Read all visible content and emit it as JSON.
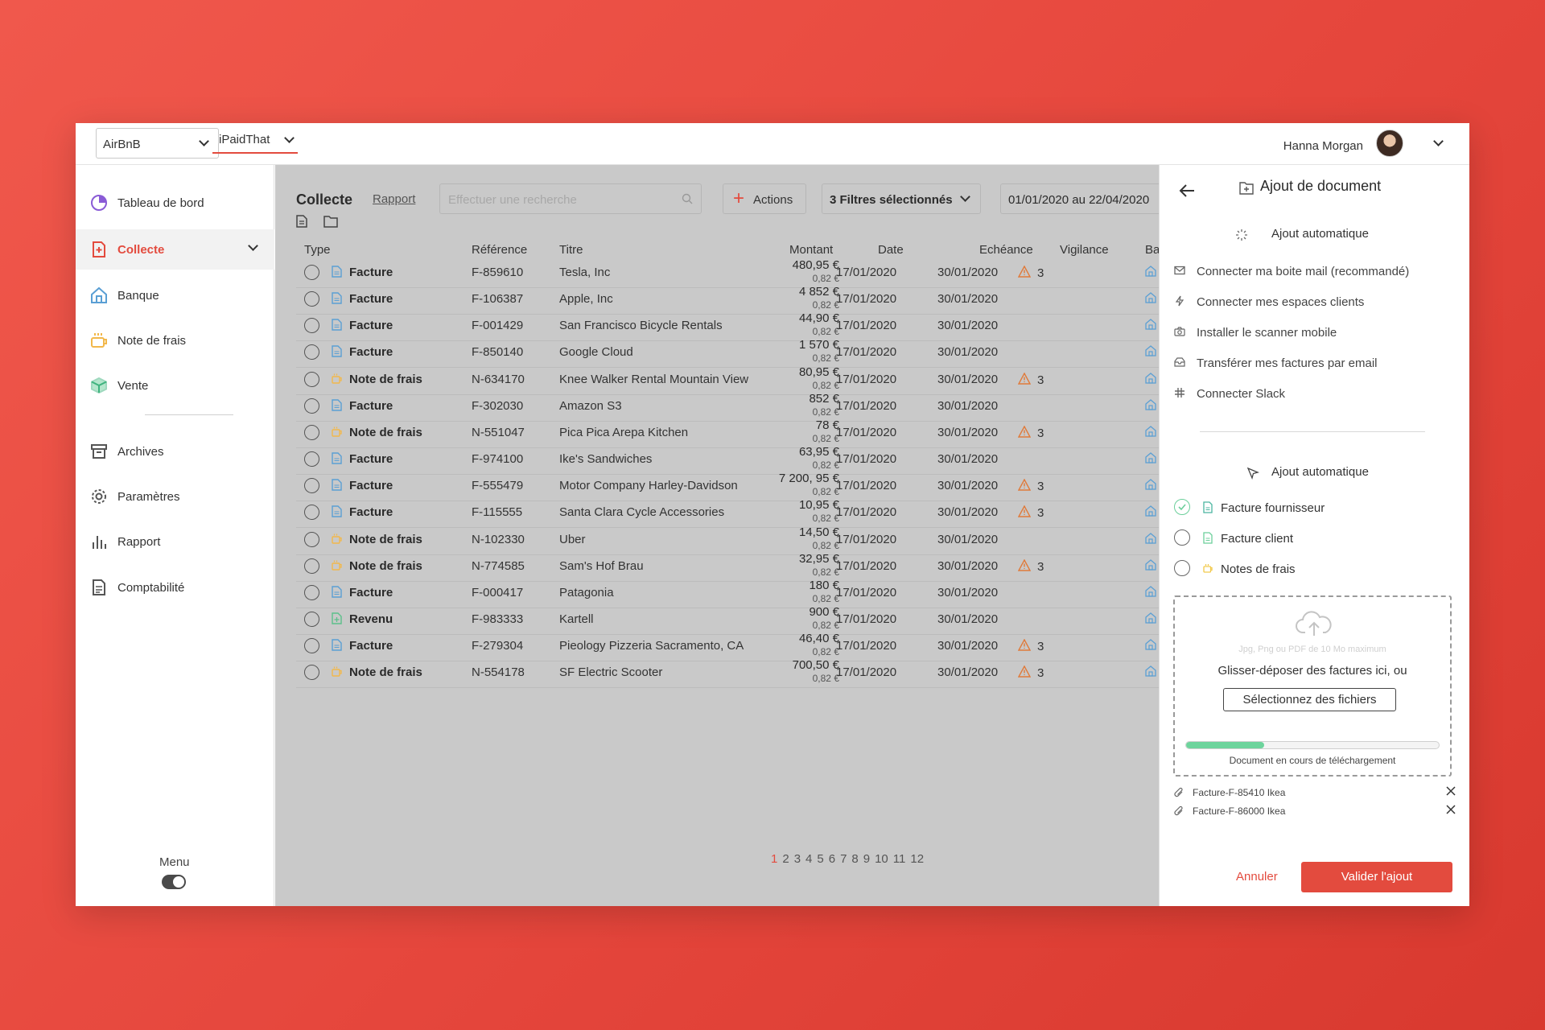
{
  "header": {
    "company_select": "AirBnB",
    "app_select": "iPaidThat",
    "user_name": "Hanna Morgan"
  },
  "sidebar": {
    "items": [
      {
        "label": "Tableau de bord",
        "icon": "dashboard-icon"
      },
      {
        "label": "Collecte",
        "icon": "collect-icon",
        "active": true
      },
      {
        "label": "Banque",
        "icon": "bank-icon"
      },
      {
        "label": "Note de frais",
        "icon": "expense-icon"
      },
      {
        "label": "Vente",
        "icon": "sale-icon"
      },
      {
        "label": "Archives",
        "icon": "archive-icon"
      },
      {
        "label": "Paramètres",
        "icon": "settings-icon"
      },
      {
        "label": "Rapport",
        "icon": "report-icon"
      },
      {
        "label": "Comptabilité",
        "icon": "accounting-icon"
      }
    ],
    "menu_label": "Menu"
  },
  "main": {
    "title": "Collecte",
    "tab_rapport": "Rapport",
    "search_placeholder": "Effectuer une recherche",
    "actions_label": "Actions",
    "filters_label": "3 Filtres sélectionnés",
    "date_range": "01/01/2020 au 22/04/2020",
    "columns": [
      "Type",
      "Référence",
      "Titre",
      "Montant",
      "Date",
      "Echéance",
      "Vigilance",
      "Banq"
    ],
    "rows": [
      {
        "type": "Facture",
        "kind": "invoice",
        "ref": "F-859610",
        "title": "Tesla, Inc",
        "amount": "480,95 €",
        "sub": "0,82 €",
        "date": "17/01/2020",
        "due": "30/01/2020",
        "vig": "3"
      },
      {
        "type": "Facture",
        "kind": "invoice",
        "ref": "F-106387",
        "title": "Apple, Inc",
        "amount": "4 852 €",
        "sub": "0,82 €",
        "date": "17/01/2020",
        "due": "30/01/2020",
        "vig": ""
      },
      {
        "type": "Facture",
        "kind": "invoice",
        "ref": "F-001429",
        "title": "San Francisco Bicycle Rentals",
        "amount": "44,90 €",
        "sub": "0,82 €",
        "date": "17/01/2020",
        "due": "30/01/2020",
        "vig": ""
      },
      {
        "type": "Facture",
        "kind": "invoice",
        "ref": "F-850140",
        "title": "Google Cloud",
        "amount": "1 570 €",
        "sub": "0,82 €",
        "date": "17/01/2020",
        "due": "30/01/2020",
        "vig": ""
      },
      {
        "type": "Note de frais",
        "kind": "expense",
        "ref": "N-634170",
        "title": "Knee Walker Rental Mountain View",
        "amount": "80,95 €",
        "sub": "0,82 €",
        "date": "17/01/2020",
        "due": "30/01/2020",
        "vig": "3"
      },
      {
        "type": "Facture",
        "kind": "invoice",
        "ref": "F-302030",
        "title": "Amazon S3",
        "amount": "852 €",
        "sub": "0,82 €",
        "date": "17/01/2020",
        "due": "30/01/2020",
        "vig": ""
      },
      {
        "type": "Note de frais",
        "kind": "expense",
        "ref": "N-551047",
        "title": "Pica Pica Arepa Kitchen",
        "amount": "78 €",
        "sub": "0,82 €",
        "date": "17/01/2020",
        "due": "30/01/2020",
        "vig": "3"
      },
      {
        "type": "Facture",
        "kind": "invoice",
        "ref": "F-974100",
        "title": "Ike's Sandwiches",
        "amount": "63,95 €",
        "sub": "0,82 €",
        "date": "17/01/2020",
        "due": "30/01/2020",
        "vig": ""
      },
      {
        "type": "Facture",
        "kind": "invoice",
        "ref": "F-555479",
        "title": "Motor Company Harley-Davidson",
        "amount": "7 200, 95 €",
        "sub": "0,82 €",
        "date": "17/01/2020",
        "due": "30/01/2020",
        "vig": "3"
      },
      {
        "type": "Facture",
        "kind": "invoice",
        "ref": "F-115555",
        "title": "Santa Clara Cycle Accessories",
        "amount": "10,95 €",
        "sub": "0,82 €",
        "date": "17/01/2020",
        "due": "30/01/2020",
        "vig": "3"
      },
      {
        "type": "Note de frais",
        "kind": "expense",
        "ref": "N-102330",
        "title": "Uber",
        "amount": "14,50 €",
        "sub": "0,82 €",
        "date": "17/01/2020",
        "due": "30/01/2020",
        "vig": ""
      },
      {
        "type": "Note de frais",
        "kind": "expense",
        "ref": "N-774585",
        "title": "Sam's Hof Brau",
        "amount": "32,95 €",
        "sub": "0,82 €",
        "date": "17/01/2020",
        "due": "30/01/2020",
        "vig": "3"
      },
      {
        "type": "Facture",
        "kind": "invoice",
        "ref": "F-000417",
        "title": "Patagonia",
        "amount": "180 €",
        "sub": "0,82 €",
        "date": "17/01/2020",
        "due": "30/01/2020",
        "vig": ""
      },
      {
        "type": "Revenu",
        "kind": "revenue",
        "ref": "F-983333",
        "title": "Kartell",
        "amount": "900 €",
        "sub": "0,82 €",
        "date": "17/01/2020",
        "due": "30/01/2020",
        "vig": ""
      },
      {
        "type": "Facture",
        "kind": "invoice",
        "ref": "F-279304",
        "title": "Pieology Pizzeria Sacramento, CA",
        "amount": "46,40 €",
        "sub": "0,82 €",
        "date": "17/01/2020",
        "due": "30/01/2020",
        "vig": "3"
      },
      {
        "type": "Note de frais",
        "kind": "expense",
        "ref": "N-554178",
        "title": "SF Electric Scooter",
        "amount": "700,50 €",
        "sub": "0,82 €",
        "date": "17/01/2020",
        "due": "30/01/2020",
        "vig": "3"
      }
    ],
    "pages": [
      "1",
      "2",
      "3",
      "4",
      "5",
      "6",
      "7",
      "8",
      "9",
      "10",
      "11",
      "12"
    ],
    "current_page": "1"
  },
  "panel": {
    "title": "Ajout de document",
    "section1_title": "Ajout automatique",
    "auto_options": [
      {
        "label": "Connecter ma boite mail (recommandé)",
        "icon": "mail-icon"
      },
      {
        "label": "Connecter mes espaces clients",
        "icon": "lightning-icon"
      },
      {
        "label": "Installer le scanner mobile",
        "icon": "camera-icon"
      },
      {
        "label": "Transférer mes factures par email",
        "icon": "inbox-icon"
      },
      {
        "label": "Connecter Slack",
        "icon": "slack-icon"
      }
    ],
    "section2_title": "Ajout automatique",
    "doc_types": [
      {
        "label": "Facture fournisseur",
        "checked": true,
        "color": "#4ab5a0"
      },
      {
        "label": "Facture client",
        "checked": false,
        "color": "#6ccf9b"
      },
      {
        "label": "Notes de frais",
        "checked": false,
        "color": "#f2c94c"
      }
    ],
    "drop_hint": "Jpg, Png ou PDF de 10 Mo maximum",
    "drop_text": "Glisser-déposer des factures ici, ou",
    "select_files": "Sélectionnez des fichiers",
    "progress": 0.31,
    "progress_label": "Document en cours de téléchargement",
    "files": [
      "Facture-F-85410 Ikea",
      "Facture-F-86000 Ikea"
    ],
    "cancel_label": "Annuler",
    "validate_label": "Valider l'ajout"
  },
  "colors": {
    "accent": "#e34b3e",
    "invoice_icon": "#5a9fd4",
    "expense_icon": "#f2b84b",
    "revenue_icon": "#5cc08a",
    "warning": "#e07a3a"
  }
}
